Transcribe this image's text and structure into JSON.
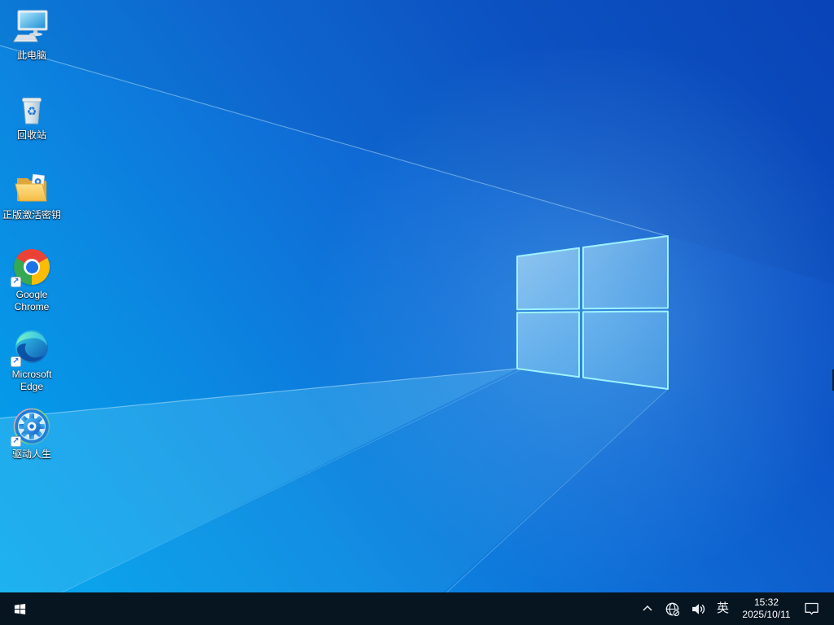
{
  "wallpaper": {
    "base_gradient": [
      "#00a6ee",
      "#0b8ae2",
      "#0f6cd6",
      "#0d55c8",
      "#0a48be"
    ],
    "logo_edge_color": "#9df2ff"
  },
  "desktop": {
    "icons": [
      {
        "id": "this-pc",
        "label": "此电脑"
      },
      {
        "id": "recycle-bin",
        "label": "回收站"
      },
      {
        "id": "activation-key-folder",
        "label": "正版激活密钥"
      },
      {
        "id": "google-chrome",
        "label": "Google Chrome"
      },
      {
        "id": "microsoft-edge",
        "label": "Microsoft Edge"
      },
      {
        "id": "driver-life",
        "label": "驱动人生"
      }
    ]
  },
  "taskbar": {
    "background": "#071520",
    "ime_indicator": "英",
    "clock": {
      "time": "15:32",
      "date": "2025/10/11"
    }
  }
}
